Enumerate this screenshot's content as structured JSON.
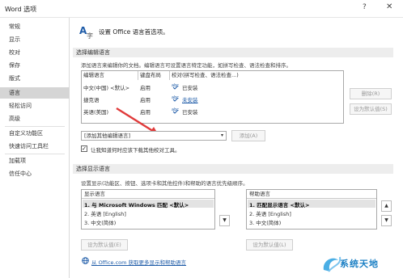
{
  "window": {
    "title": "Word 选项",
    "help": "?",
    "close": "✕"
  },
  "sidebar": {
    "items": [
      "常规",
      "显示",
      "校对",
      "保存",
      "版式",
      "语言",
      "轻松访问",
      "高级",
      "自定义功能区",
      "快速访问工具栏",
      "加载项",
      "信任中心"
    ],
    "active_index": 5
  },
  "header": {
    "text": "设置 Office 语言首选项。",
    "icon": "language-icon"
  },
  "editing": {
    "section_title": "选择编辑语言",
    "description": "添加语言来编辑你的文档。编辑语言可设置语言特定功能，如拼写检查、语法检查和排序。",
    "columns": [
      "编辑语言",
      "键盘布局",
      "校对(拼写检查、语法检查...)"
    ],
    "rows": [
      {
        "language": "中文(中国) <默认>",
        "keyboard": "启用",
        "proofing": "已安装",
        "proof_link": false
      },
      {
        "language": "捷克语",
        "keyboard": "启用",
        "proofing": "未安装",
        "proof_link": true
      },
      {
        "language": "英语(美国)",
        "keyboard": "启用",
        "proofing": "已安装",
        "proof_link": false
      }
    ],
    "remove_button": "删除(R)",
    "set_default_button": "设为默认值(S)",
    "add_dropdown_value": "[添加其他编辑语言]",
    "add_button": "添加(A)",
    "checkbox_label": "让我知道何时应该下载其他校对工具。",
    "checkbox_checked": true
  },
  "display": {
    "section_title": "选择显示语言",
    "description": "设置显示(功能区、按钮、选项卡和其他控件)和帮助的语言优先级顺序。",
    "display_list": {
      "header": "显示语言",
      "items": [
        "1.    与 Microsoft Windows 匹配 <默认>",
        "2.    英语 [English]",
        "3.    中文(简体)"
      ]
    },
    "help_list": {
      "header": "帮助语言",
      "items": [
        "1.    匹配显示语言 <默认>",
        "2.    英语 [English]",
        "3.    中文(简体)"
      ]
    },
    "set_default_button_left": "设为默认值(E)",
    "set_default_button_right": "设为默认值(L)",
    "link_text": "从 Office.com 获取更多显示和帮助语言"
  },
  "watermark": {
    "text": "系统天地"
  },
  "colors": {
    "accent": "#1f5ca8",
    "selected": "#d5d5d5",
    "arrow": "#e03a3a"
  }
}
